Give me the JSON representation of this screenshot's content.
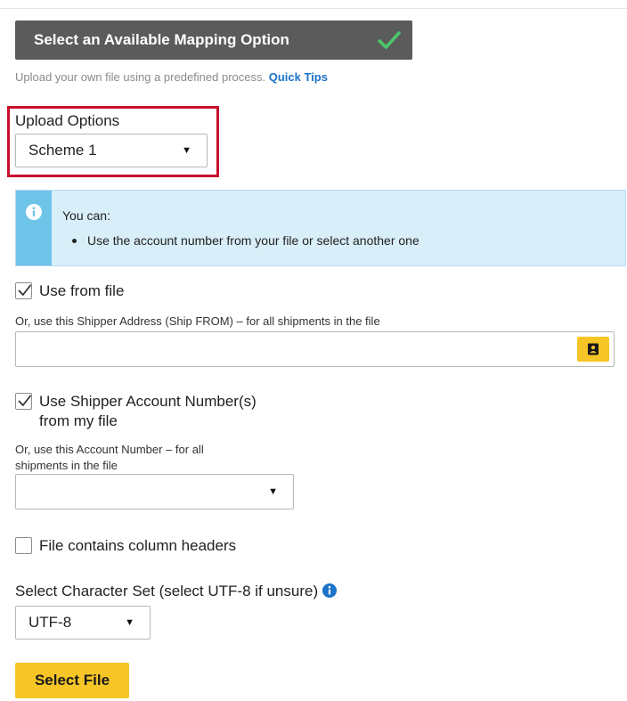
{
  "mapping": {
    "title": "Select an Available Mapping Option",
    "status_icon": "check-icon",
    "accent_color": "#4cc56a"
  },
  "hint": {
    "text": "Upload your own file using a predefined process. ",
    "link": "Quick Tips"
  },
  "upload_options": {
    "label": "Upload Options",
    "selected": "Scheme 1"
  },
  "info": {
    "icon": "info-icon",
    "heading": "You can:",
    "bullets": [
      "Use the account number from your file or select another one"
    ]
  },
  "use_from_file": {
    "label": "Use from file",
    "checked": true
  },
  "shipper_address": {
    "label": "Or, use this Shipper Address (Ship FROM) – for all shipments in the file",
    "value": "",
    "button_icon": "address-book-icon"
  },
  "use_account_numbers": {
    "label_line1": "Use Shipper Account Number(s)",
    "label_line2": "from my file",
    "checked": true
  },
  "account_number": {
    "label_line1": "Or, use this Account Number – for all",
    "label_line2": "shipments in the file",
    "selected": ""
  },
  "column_headers": {
    "label": "File contains column headers",
    "checked": false
  },
  "charset": {
    "label": "Select Character Set (select UTF-8 if unsure)",
    "selected": "UTF-8"
  },
  "select_file": {
    "label": "Select File"
  },
  "colors": {
    "highlight": "#c8102e",
    "button_yellow": "#f7c626",
    "link_blue": "#1a73c9",
    "info_background": "#d8eef9"
  }
}
